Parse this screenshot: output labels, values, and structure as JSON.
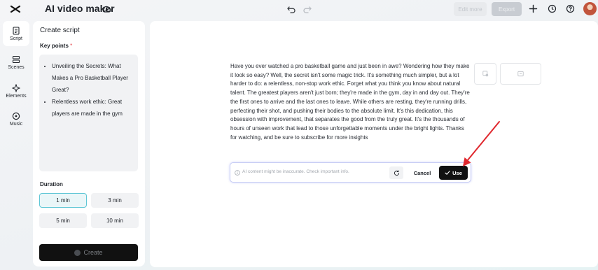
{
  "app": {
    "title": "AI video maker"
  },
  "topbar": {
    "edit_more_label": "Edit more",
    "export_label": "Export"
  },
  "rail": {
    "items": [
      {
        "label": "Script",
        "icon": "script-icon",
        "active": true
      },
      {
        "label": "Scenes",
        "icon": "scenes-icon",
        "active": false
      },
      {
        "label": "Elements",
        "icon": "elements-icon",
        "active": false
      },
      {
        "label": "Music",
        "icon": "music-icon",
        "active": false
      }
    ]
  },
  "panel": {
    "title": "Create script",
    "key_points_label": "Key points",
    "required_mark": "*",
    "key_points": [
      "Unveiling the Secrets: What Makes a Pro Basketball Player Great?",
      "Relentless work ethic: Great players are made in the gym"
    ],
    "duration_label": "Duration",
    "durations": [
      {
        "label": "1 min",
        "selected": true
      },
      {
        "label": "3 min",
        "selected": false
      },
      {
        "label": "5 min",
        "selected": false
      },
      {
        "label": "10 min",
        "selected": false
      }
    ],
    "create_label": "Create"
  },
  "main": {
    "script": "Have you ever watched a pro basketball game and just been in awe? Wondering how they make it look so easy? Well, the secret isn't some magic trick. It's something much simpler, but a lot harder to do: a relentless, non-stop work ethic. Forget what you think you know about natural talent. The greatest players aren't just born; they're made in the gym, day in and day out. They're the first ones to arrive and the last ones to leave. While others are resting, they're running drills, perfecting their shot, and pushing their bodies to the absolute limit. It's this dedication, this obsession with improvement, that separates the good from the truly great. It's the thousands of hours of unseen work that lead to those unforgettable moments under the bright lights. Thanks for watching, and be sure to subscribe for more insights",
    "disclaimer": "AI content might be inaccurate. Check important info.",
    "cancel_label": "Cancel",
    "use_label": "Use"
  },
  "colors": {
    "accent_border": "#5fc7d6",
    "annotation_arrow": "#e0282e",
    "primary_button": "#111111"
  }
}
